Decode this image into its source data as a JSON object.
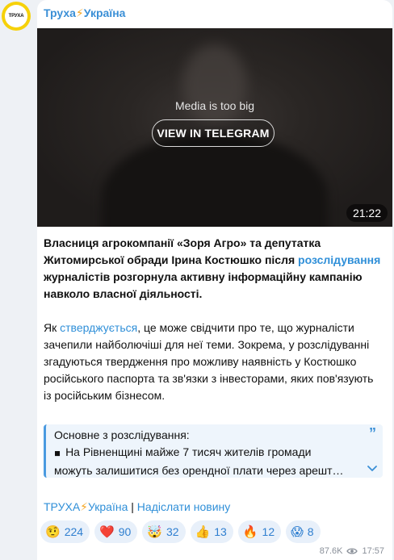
{
  "avatar": {
    "text": "ТРУХА"
  },
  "channel": {
    "name_part1": "Труха",
    "bolt": "⚡",
    "name_part2": "Україна"
  },
  "media": {
    "notice": "Media is too big",
    "button_label": "VIEW IN TELEGRAM",
    "duration": "21:22"
  },
  "post": {
    "p1_a": "Власниця агрокомпанії «Зоря Агро» та депутатка Житомирської обради Ірина Костюшко після ",
    "p1_link": "розслідування",
    "p1_b": " журналістів розгорнула активну інформаційну кампанію навколо власної діяльності.",
    "p2_a": "Як ",
    "p2_link": "стверджується",
    "p2_b": ", це може свідчити про те, що журналісти зачепили найболючіші для неї теми. Зокрема, у розслідуванні згадуються твердження про можливу наявність у Костюшко російського паспорта та зв'язки з інвесторами, яких пов'язують із російським бізнесом."
  },
  "quote": {
    "heading": "Основне з розслідування:",
    "bullet": "◾",
    "line1": "На Рівненщині майже 7 тисяч жителів громади",
    "line2": "можуть залишитися без орендної плати через арешт…",
    "mark": "”"
  },
  "footer": {
    "link1_a": "ТРУХА",
    "link1_bolt": "⚡",
    "link1_b": "Україна",
    "separator": " | ",
    "link2": "Надіслати новину"
  },
  "reactions": [
    {
      "emoji": "🤨",
      "count": "224",
      "icon": "raised-eyebrow-face-icon"
    },
    {
      "emoji": "❤️",
      "count": "90",
      "icon": "red-heart-icon"
    },
    {
      "emoji": "🤯",
      "count": "32",
      "icon": "exploding-head-icon"
    },
    {
      "emoji": "👍",
      "count": "13",
      "icon": "thumbs-up-icon"
    },
    {
      "emoji": "🔥",
      "count": "12",
      "icon": "fire-icon"
    },
    {
      "emoji": "😱",
      "count": "8",
      "icon": "screaming-face-icon"
    }
  ],
  "meta": {
    "views": "87.6K",
    "time": "17:57"
  },
  "colors": {
    "accent": "#3a8fd6",
    "avatar_ring": "#f6d10a",
    "reaction_bg": "#e8f0fa"
  }
}
